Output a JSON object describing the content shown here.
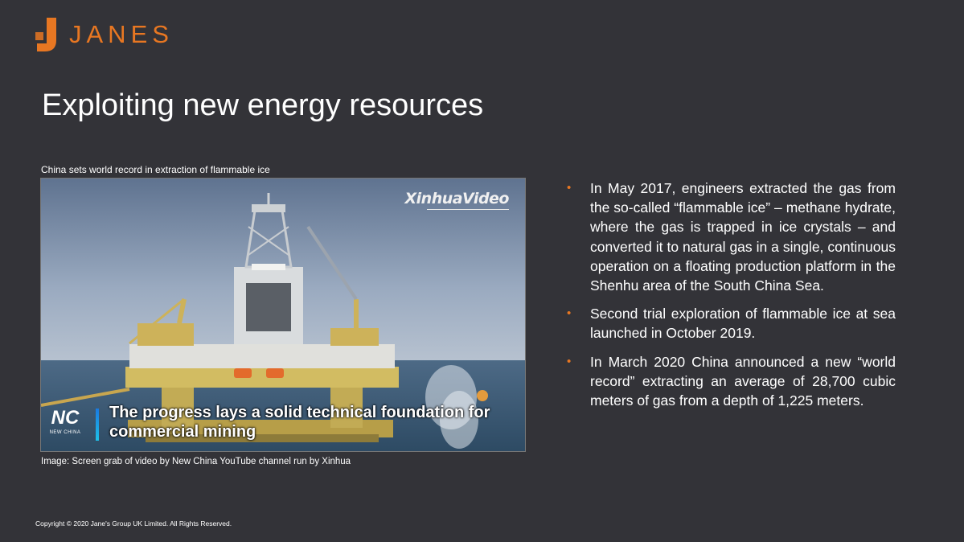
{
  "brand": {
    "name": "JANES",
    "accent_color": "#e87722",
    "logo_icon": "janes-j-mark-icon"
  },
  "slide": {
    "title": "Exploiting new energy resources"
  },
  "image": {
    "caption_top": "China sets world record in extraction of flammable ice",
    "watermark": "XinhuaVideo",
    "channel_logo_text": "NC",
    "channel_logo_subtext": "NEW CHINA",
    "subtitle": "The progress lays a solid technical foundation for commercial mining",
    "caption_bottom": "Image: Screen grab of video by New China YouTube channel run by Xinhua"
  },
  "bullets": [
    {
      "text": "In May 2017, engineers extracted the gas from the so-called “flammable ice” – methane hydrate, where the gas is trapped in ice crystals – and converted it to natural gas in a single, continuous operation on a floating production platform in the Shenhu area of the South China Sea."
    },
    {
      "text": "Second trial exploration of flammable ice at sea launched in October 2019."
    },
    {
      "text": "In March 2020 China announced a new “world record”  extracting an average of 28,700 cubic meters of gas from a depth of 1,225 meters."
    }
  ],
  "footer": {
    "copyright": "Copyright © 2020 Jane's Group UK Limited. All Rights Reserved."
  }
}
